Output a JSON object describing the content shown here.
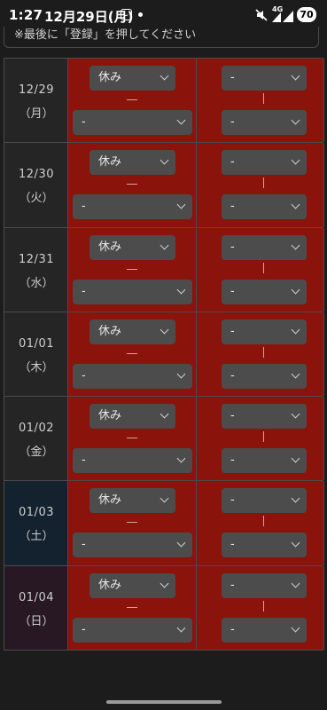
{
  "status_bar": {
    "time": "1:27",
    "date": "12月29日(月)",
    "network": "4G",
    "battery": "70"
  },
  "notice": "※最後に「登録」を押してください",
  "rows": [
    {
      "date": "12/29",
      "weekday": "（月）",
      "start": "休み",
      "end": "-",
      "b_start": "-",
      "b_end": "-"
    },
    {
      "date": "12/30",
      "weekday": "（火）",
      "start": "休み",
      "end": "-",
      "b_start": "-",
      "b_end": "-"
    },
    {
      "date": "12/31",
      "weekday": "（水）",
      "start": "休み",
      "end": "-",
      "b_start": "-",
      "b_end": "-"
    },
    {
      "date": "01/01",
      "weekday": "（木）",
      "start": "休み",
      "end": "-",
      "b_start": "-",
      "b_end": "-"
    },
    {
      "date": "01/02",
      "weekday": "（金）",
      "start": "休み",
      "end": "-",
      "b_start": "-",
      "b_end": "-"
    },
    {
      "date": "01/03",
      "weekday": "（土）",
      "start": "休み",
      "end": "-",
      "b_start": "-",
      "b_end": "-"
    },
    {
      "date": "01/04",
      "weekday": "（日）",
      "start": "休み",
      "end": "-",
      "b_start": "-",
      "b_end": "-"
    }
  ],
  "colors": {
    "cell_red": "#8a140b",
    "saturday": "#13222e",
    "sunday": "#271824",
    "select_bg": "#4c4c4c"
  }
}
